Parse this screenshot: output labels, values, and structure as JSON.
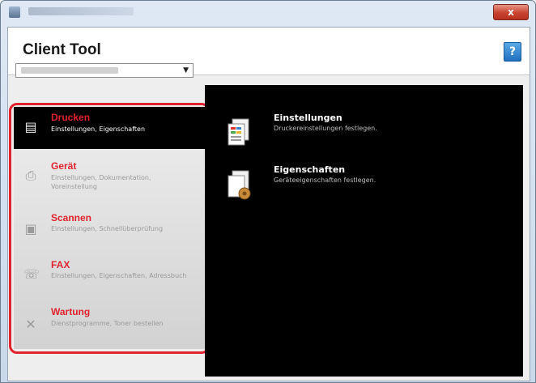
{
  "window": {
    "close_label": "x"
  },
  "header": {
    "title": "Client Tool",
    "help_label": "?"
  },
  "device_select": {
    "selected": ""
  },
  "sidebar": {
    "items": [
      {
        "title": "Drucken",
        "desc": "Einstellungen, Eigenschaften",
        "icon": "printer-document-icon",
        "active": true
      },
      {
        "title": "Gerät",
        "desc": "Einstellungen, Dokumentation, Voreinstellung",
        "icon": "device-icon",
        "active": false
      },
      {
        "title": "Scannen",
        "desc": "Einstellungen, Schnellüberprüfung",
        "icon": "scanner-icon",
        "active": false
      },
      {
        "title": "FAX",
        "desc": "Einstellungen, Eigenschaften, Adressbuch",
        "icon": "fax-icon",
        "active": false
      },
      {
        "title": "Wartung",
        "desc": "Dienstprogramme, Toner bestellen",
        "icon": "wrench-icon",
        "active": false
      }
    ]
  },
  "main": {
    "tiles": [
      {
        "title": "Einstellungen",
        "desc": "Druckereinstellungen festlegen.",
        "icon": "print-settings-icon"
      },
      {
        "title": "Eigenschaften",
        "desc": "Geräteeigenschaften festlegen.",
        "icon": "properties-icon"
      }
    ]
  },
  "colors": {
    "accent_red": "#e0232e",
    "panel_bg": "#000000",
    "help_blue": "#2b7fd0"
  }
}
